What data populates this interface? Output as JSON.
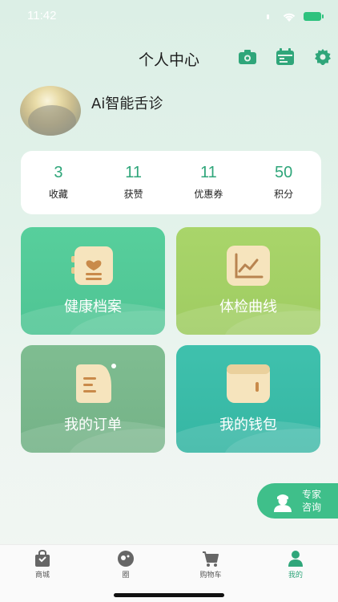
{
  "status_bar": {
    "time": "11:42"
  },
  "header": {
    "title": "个人中心"
  },
  "header_icons": [
    "camera-icon",
    "calendar-icon",
    "gear-icon"
  ],
  "profile": {
    "username": "Ai智能舌诊"
  },
  "stats": [
    {
      "value": "3",
      "label": "收藏"
    },
    {
      "value": "11",
      "label": "获赞"
    },
    {
      "value": "11",
      "label": "优惠券"
    },
    {
      "value": "50",
      "label": "积分"
    }
  ],
  "cards": [
    {
      "label": "健康档案",
      "icon": "health-record-icon"
    },
    {
      "label": "体检曲线",
      "icon": "chart-curve-icon"
    },
    {
      "label": "我的订单",
      "icon": "order-icon"
    },
    {
      "label": "我的钱包",
      "icon": "wallet-icon"
    }
  ],
  "consult": {
    "line1": "专家",
    "line2": "咨询"
  },
  "tabbar": [
    {
      "label": "商城",
      "icon": "shop-bag-icon"
    },
    {
      "label": "圈",
      "icon": "circle-icon"
    },
    {
      "label": "购物车",
      "icon": "cart-icon"
    },
    {
      "label": "我的",
      "icon": "user-icon"
    }
  ],
  "colors": {
    "accent": "#2fa67a",
    "card_health": "#57cf9c",
    "card_curve": "#a9d56a",
    "card_order": "#7fbd91",
    "card_wallet": "#3fc1ad",
    "consult": "#3fbf8a"
  }
}
